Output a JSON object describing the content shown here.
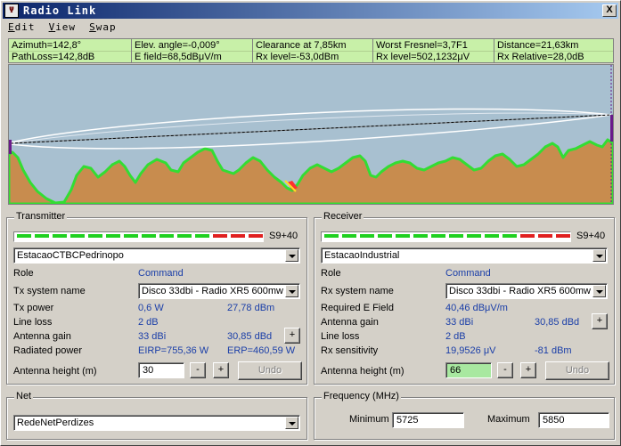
{
  "window": {
    "title": "Radio Link",
    "icon_name": "radio-tower-icon",
    "close_label": "X"
  },
  "menu": [
    "Edit",
    "View",
    "Swap"
  ],
  "info": {
    "row1": [
      "Azimuth=142,8°",
      "Elev. angle=-0,009°",
      "Clearance at 7,85km",
      "Worst Fresnel=3,7F1",
      "Distance=21,63km"
    ],
    "row2": [
      "PathLoss=142,8dB",
      "E field=68,5dBμV/m",
      "Rx level=-53,0dBm",
      "Rx level=502,1232μV",
      "Rx Relative=28,0dB"
    ]
  },
  "profile": {
    "sky_color": "#a8c0d0",
    "terrain_color": "#c88c4e",
    "terrain_edge_color": "#33dd33",
    "fresnel_color": "#ffffff",
    "los_color": "#000000"
  },
  "transmitter": {
    "title": "Transmitter",
    "signal_label": "S9+40",
    "signal_segments": {
      "green": 11,
      "red": 3
    },
    "station": "EstacaoCTBCPedrinopo",
    "role_label": "Role",
    "role_value": "Command",
    "system_label": "Tx system name",
    "system_value": "Disco 33dbi - Radio XR5 600mw",
    "power_label": "Tx power",
    "power_w": "0,6 W",
    "power_dbm": "27,78 dBm",
    "line_loss_label": "Line loss",
    "line_loss_value": "2 dB",
    "gain_label": "Antenna gain",
    "gain_dbi": "33 dBi",
    "gain_dbd": "30,85 dBd",
    "radiated_label": "Radiated power",
    "eirp": "EIRP=755,36 W",
    "erp": "ERP=460,59 W",
    "height_label": "Antenna height (m)",
    "height_value": "30",
    "minus": "-",
    "plus": "+",
    "undo": "Undo"
  },
  "receiver": {
    "title": "Receiver",
    "signal_label": "S9+40",
    "signal_segments": {
      "green": 11,
      "red": 3
    },
    "station": "EstacaoIndustrial",
    "role_label": "Role",
    "role_value": "Command",
    "system_label": "Rx system name",
    "system_value": "Disco 33dbi - Radio XR5 600mw",
    "required_label": "Required E Field",
    "required_value": "40,46 dBμV/m",
    "gain_label": "Antenna gain",
    "gain_dbi": "33 dBi",
    "gain_dbd": "30,85 dBd",
    "line_loss_label": "Line loss",
    "line_loss_value": "2 dB",
    "sens_label": "Rx sensitivity",
    "sens_uv": "19,9526 μV",
    "sens_dbm": "-81 dBm",
    "height_label": "Antenna height (m)",
    "height_value": "66",
    "minus": "-",
    "plus": "+",
    "undo": "Undo"
  },
  "net": {
    "title": "Net",
    "value": "RedeNetPerdizes"
  },
  "frequency": {
    "title": "Frequency (MHz)",
    "min_label": "Minimum",
    "min_value": "5725",
    "max_label": "Maximum",
    "max_value": "5850"
  }
}
